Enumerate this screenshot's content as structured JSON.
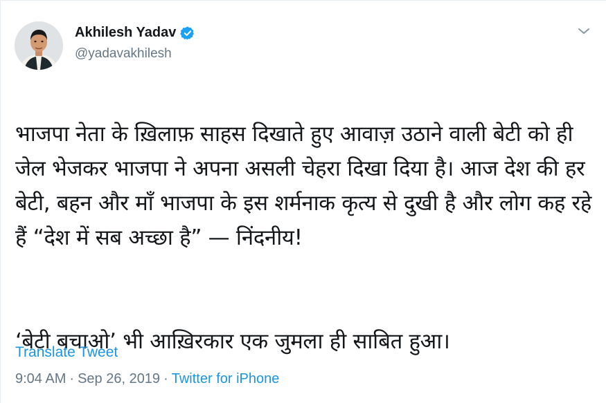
{
  "author": {
    "name": "Akhilesh Yadav",
    "handle": "@yadavakhilesh",
    "verified": true
  },
  "tweet": {
    "paragraph1": "भाजपा नेता के ख़िलाफ़ साहस दिखाते हुए आवाज़ उठाने वाली बेटी को ही जेल भेजकर भाजपा ने अपना असली चेहरा दिखा दिया है। आज देश की हर बेटी, बहन और माँ भाजपा के इस शर्मनाक कृत्य से दुखी है और लोग कह रहे हैं “देश में सब अच्छा है” — निंदनीय!",
    "paragraph2": "‘बेटी बचाओ’ भी आख़िरकार एक जुमला ही साबित हुआ।"
  },
  "translate_label": "Translate Tweet",
  "meta": {
    "time": "9:04 AM",
    "separator": "·",
    "date": "Sep 26, 2019",
    "separator2": "·",
    "source": "Twitter for iPhone"
  },
  "colors": {
    "link": "#1b95e0",
    "secondary_text": "#657786",
    "verified_badge": "#1da1f2"
  },
  "icons": {
    "verified": "verified-badge-icon",
    "menu": "chevron-down-icon"
  }
}
